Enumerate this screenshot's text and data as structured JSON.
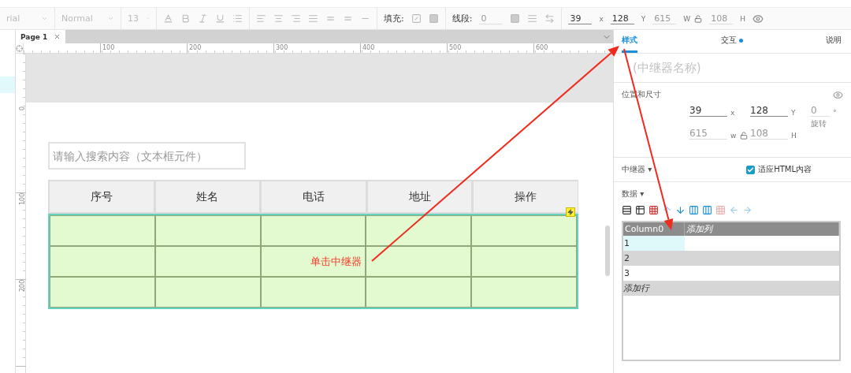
{
  "toolbar": {
    "font": "rial",
    "style": "Normal",
    "size": "13",
    "fill_label": "填充:",
    "stroke_label": "线段:",
    "stroke_value": "0",
    "geometry": [
      {
        "value": "39",
        "unit": "x",
        "disabled": false,
        "lock_after": false
      },
      {
        "value": "128",
        "unit": "Y",
        "disabled": false,
        "lock_after": false
      },
      {
        "value": "615",
        "unit": "W",
        "disabled": true,
        "lock_after": true
      },
      {
        "value": "108",
        "unit": "H",
        "disabled": true,
        "lock_after": false
      }
    ]
  },
  "page_tabs": [
    {
      "label": "Page 1",
      "selected": true
    }
  ],
  "ruler": {
    "horizontal": [
      "100",
      "200",
      "300",
      "400",
      "500",
      "600"
    ],
    "vertical": [
      "0",
      "100",
      "200"
    ]
  },
  "search_field": {
    "placeholder": "请输入搜索内容（文本框元件）"
  },
  "table": {
    "columns": [
      "序号",
      "姓名",
      "电话",
      "地址",
      "操作"
    ],
    "rows": [
      {
        "kind": "blank"
      },
      {
        "kind": "blank",
        "note": "单击中继器"
      },
      {
        "kind": "blank"
      }
    ]
  },
  "inspector": {
    "tabs": [
      {
        "label": "样式",
        "selected": true,
        "dot": false
      },
      {
        "label": "交互",
        "selected": false,
        "dot": true
      },
      {
        "label": "说明",
        "selected": false,
        "dot": false
      }
    ],
    "name_placeholder": "(中继器名称)",
    "position_title": "位置和尺寸",
    "position_fields": [
      {
        "value": "39",
        "unit": "x",
        "disabled": false,
        "lock_after": false
      },
      {
        "value": "128",
        "unit": "Y",
        "disabled": false,
        "lock_after": false
      },
      {
        "value": "0",
        "unit": "°",
        "disabled": true,
        "caption": "旋转",
        "lock_after": false
      },
      {
        "value": "615",
        "unit": "w",
        "disabled": true,
        "lock_after": true
      },
      {
        "value": "108",
        "unit": "H",
        "disabled": true,
        "lock_after": false
      }
    ],
    "repeater_label": "中继器 ▾",
    "fit_html": {
      "label": "适应HTML内容",
      "checked": true
    },
    "data_label": "数据 ▾",
    "grid": {
      "columns": [
        "Column0",
        "添加列"
      ],
      "rows": [
        {
          "value": "1",
          "selected": true
        },
        {
          "value": "2",
          "selected": false
        },
        {
          "value": "3",
          "selected": false
        }
      ],
      "add_row": "添加行"
    }
  }
}
